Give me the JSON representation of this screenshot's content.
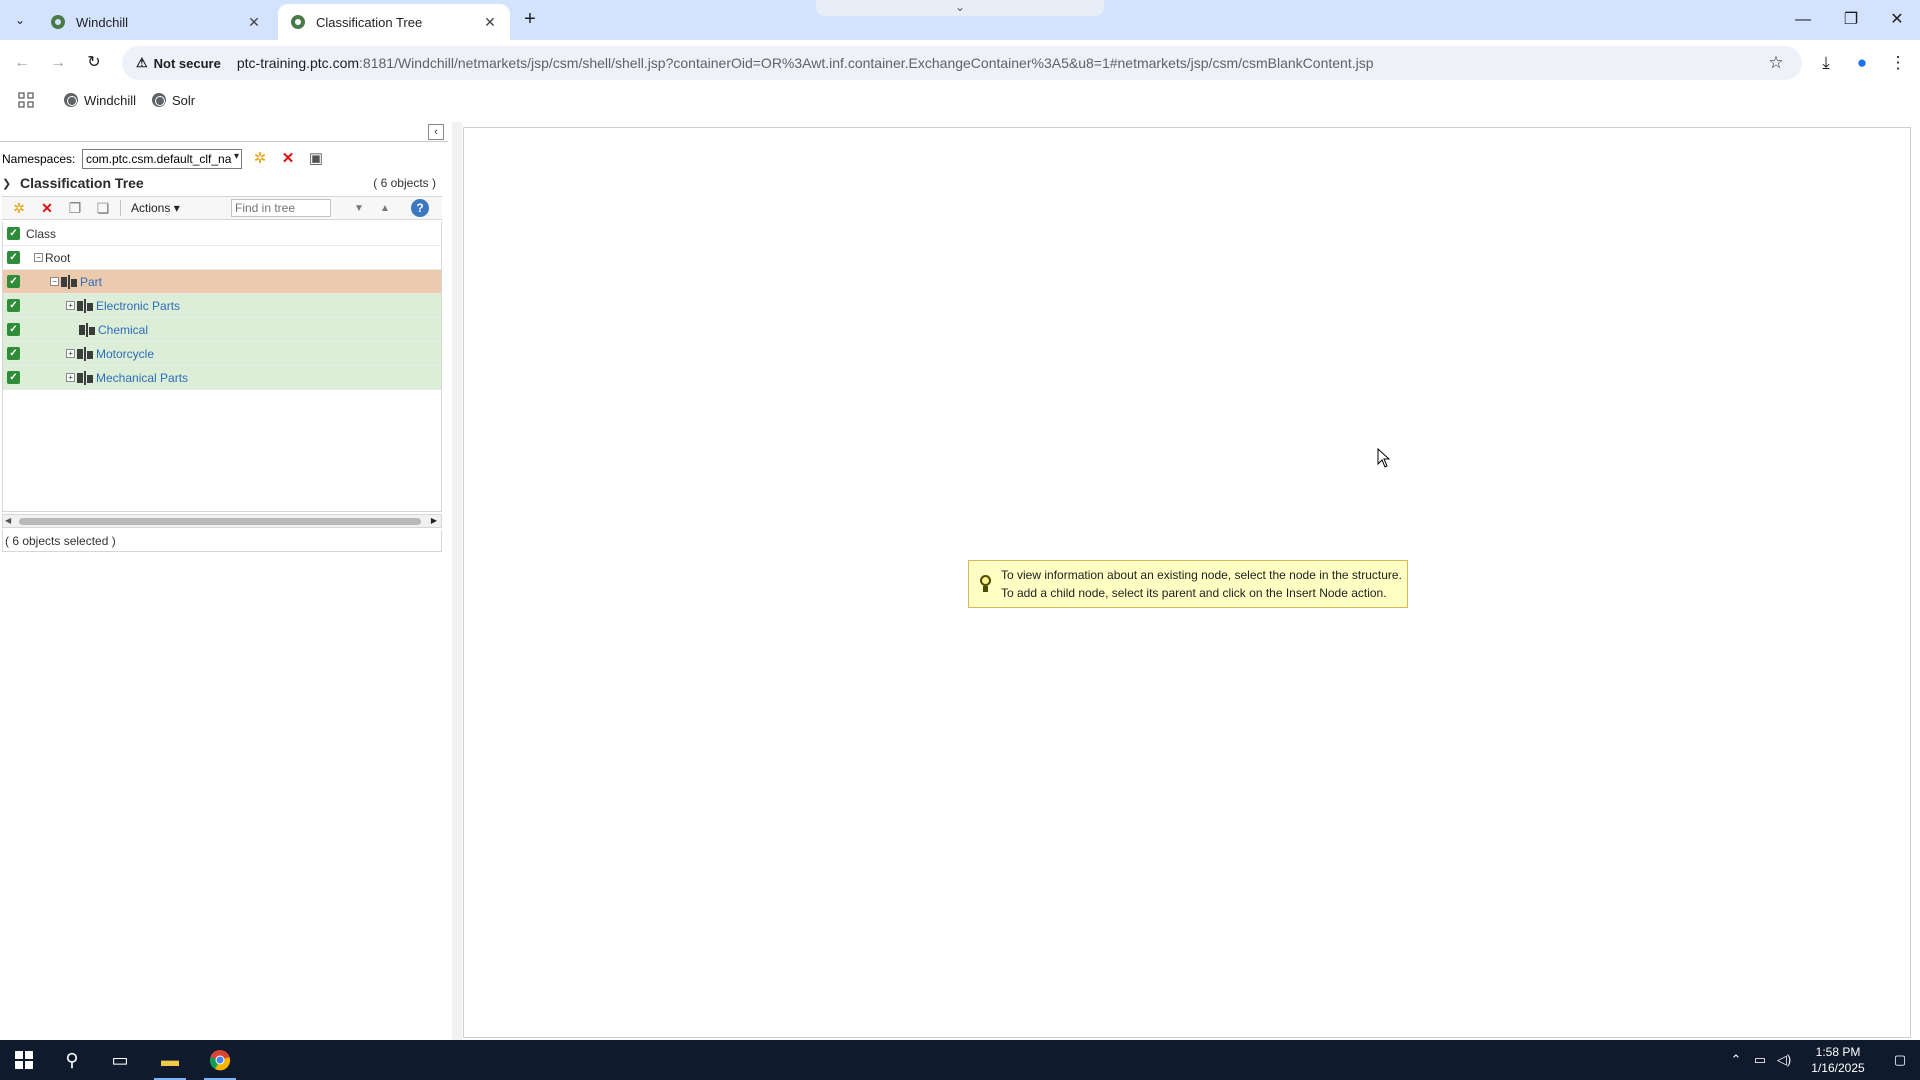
{
  "browser": {
    "tabs": [
      {
        "title": "Windchill",
        "active": false
      },
      {
        "title": "Classification Tree",
        "active": true
      }
    ],
    "security_label": "Not secure",
    "url_host": "ptc-training.ptc.com",
    "url_rest": ":8181/Windchill/netmarkets/jsp/csm/shell/shell.jsp?containerOid=OR%3Awt.inf.container.ExchangeContainer%3A5&u8=1#netmarkets/jsp/csm/csmBlankContent.jsp",
    "bookmarks": [
      "Windchill",
      "Solr"
    ]
  },
  "left_panel": {
    "namespaces_label": "Namespaces:",
    "namespace_value": "com.ptc.csm.default_clf_na",
    "tree_title": "Classification Tree",
    "object_count": "( 6 objects )",
    "actions_label": "Actions",
    "find_placeholder": "Find in tree",
    "column_header": "Class",
    "nodes": [
      {
        "label": "Root",
        "expander": "−",
        "level": 0,
        "state": "normal"
      },
      {
        "label": "Part",
        "expander": "−",
        "level": 1,
        "state": "selected"
      },
      {
        "label": "Electronic Parts",
        "expander": "+",
        "level": 2,
        "state": "highlight"
      },
      {
        "label": "Chemical",
        "expander": "",
        "level": 2,
        "state": "highlight"
      },
      {
        "label": "Motorcycle",
        "expander": "+",
        "level": 2,
        "state": "highlight"
      },
      {
        "label": "Mechanical Parts",
        "expander": "+",
        "level": 2,
        "state": "highlight"
      }
    ],
    "selection_status": "( 6 objects selected )"
  },
  "content": {
    "info_line_1": "To view information about an existing node, select the node in the structure.",
    "info_line_2": "To add a child node, select its parent and click on the Insert Node action."
  },
  "taskbar": {
    "time": "1:58 PM",
    "date": "1/16/2025"
  },
  "colors": {
    "selected_row": "#eccaae",
    "highlight_row": "#dcedd8",
    "link": "#2e6fb7",
    "info_bg": "#ffffc4"
  }
}
